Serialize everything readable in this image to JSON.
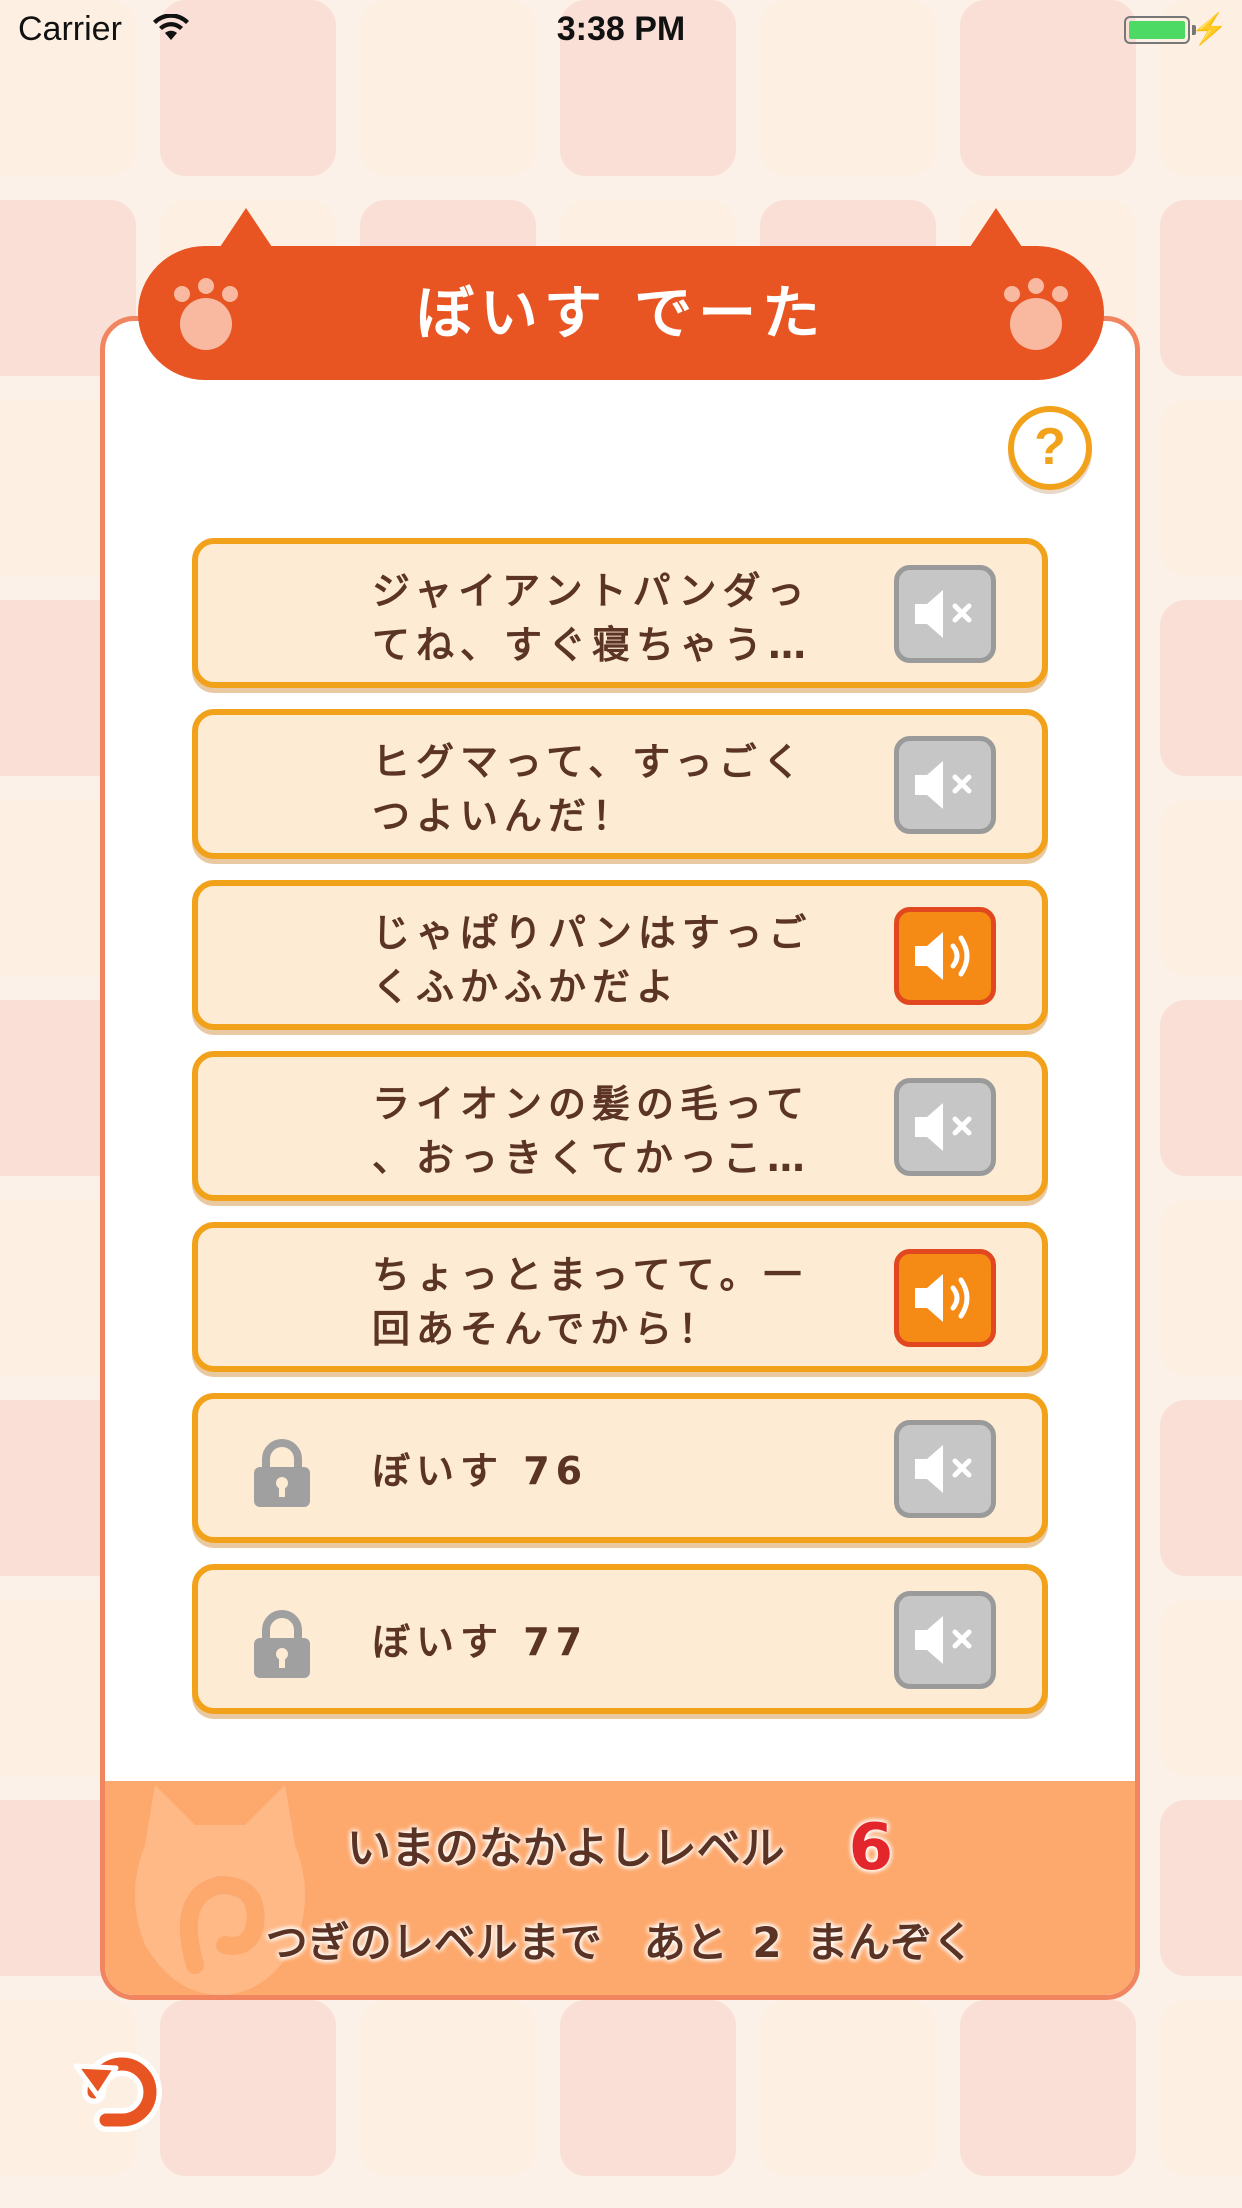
{
  "status_bar": {
    "carrier": "Carrier",
    "time": "3:38 PM",
    "battery_level": 1.0
  },
  "header": {
    "title": "ぼいす でーた"
  },
  "help_button": {
    "label": "?"
  },
  "voice_items": [
    {
      "text": "ジャイアントパンダっ\nてね、すぐ寝ちゃう…",
      "locked": false,
      "sound": "off"
    },
    {
      "text": "ヒグマって、すっごく\nつよいんだ！",
      "locked": false,
      "sound": "off"
    },
    {
      "text": "じゃぱりパンはすっご\nくふかふかだよ",
      "locked": false,
      "sound": "on"
    },
    {
      "text": "ライオンの髪の毛って\n、おっきくてかっこ…",
      "locked": false,
      "sound": "off"
    },
    {
      "text": "ちょっとまってて。一\n回あそんでから！",
      "locked": false,
      "sound": "on"
    },
    {
      "text": "ぼいす 76",
      "locked": true,
      "sound": "off"
    },
    {
      "text": "ぼいす 77",
      "locked": true,
      "sound": "off"
    }
  ],
  "footer": {
    "level_label": "いまのなかよしレベル",
    "level_value": "6",
    "next_level_text": "つぎのレベルまで　あと 2 まんぞく"
  },
  "colors": {
    "accent": "#e85522",
    "item_border": "#f2a21a",
    "item_fill": "#fdecd3",
    "sound_on": "#f58a14",
    "sound_off": "#c6c6c6",
    "footer": "#fda96d",
    "level_value": "#e3262b"
  }
}
